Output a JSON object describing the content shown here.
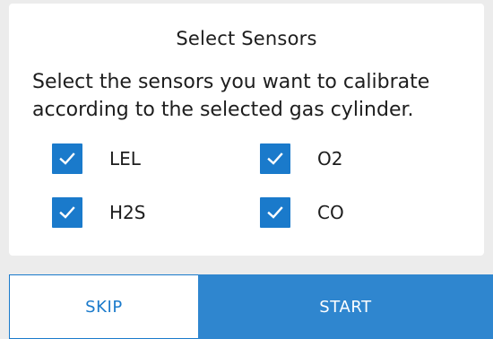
{
  "dialog": {
    "title": "Select Sensors",
    "message": "Select the sensors you want to calibrate according to the selected gas cylinder."
  },
  "sensors": [
    {
      "label": "LEL",
      "checked": true
    },
    {
      "label": "O2",
      "checked": true
    },
    {
      "label": "H2S",
      "checked": true
    },
    {
      "label": "CO",
      "checked": true
    }
  ],
  "actions": {
    "skip_label": "SKIP",
    "start_label": "START"
  },
  "colors": {
    "accent": "#1a7acb",
    "primary_button": "#2f86cf",
    "background": "#ececec",
    "card": "#ffffff"
  },
  "icons": {
    "checkbox_checked": "check-icon"
  }
}
